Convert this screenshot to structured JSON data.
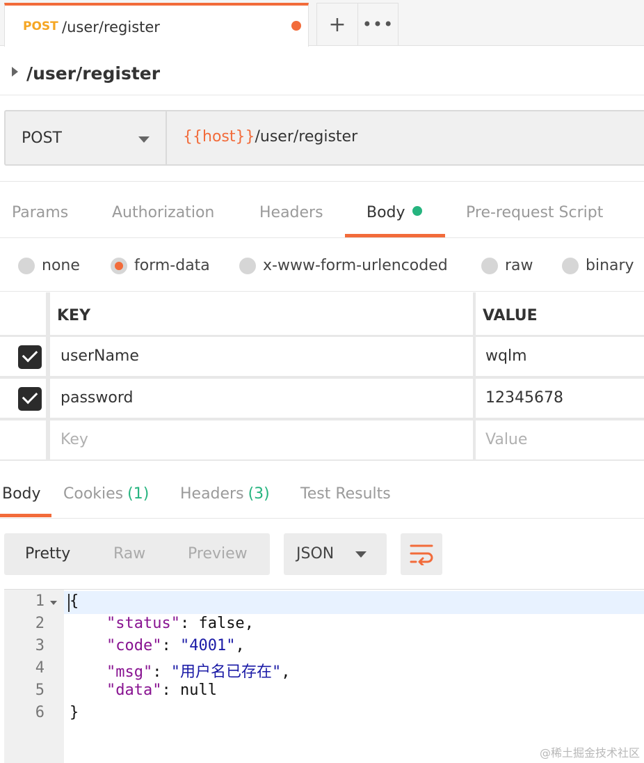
{
  "tab": {
    "method": "POST",
    "name": "/user/register"
  },
  "tab_buttons": {
    "add": "+",
    "more": "•••"
  },
  "request": {
    "title": "/user/register",
    "method": "POST",
    "url_var": "{{host}}",
    "url_path": "/user/register"
  },
  "request_tabs": [
    "Params",
    "Authorization",
    "Headers",
    "Body",
    "Pre-request Script"
  ],
  "body_types": [
    "none",
    "form-data",
    "x-www-form-urlencoded",
    "raw",
    "binary"
  ],
  "table": {
    "key_header": "KEY",
    "value_header": "VALUE",
    "rows": [
      {
        "key": "userName",
        "value": "wqlm"
      },
      {
        "key": "password",
        "value": "12345678"
      }
    ],
    "key_placeholder": "Key",
    "value_placeholder": "Value"
  },
  "response_tabs": {
    "body": "Body",
    "cookies": "Cookies",
    "cookies_count": "(1)",
    "headers": "Headers",
    "headers_count": "(3)",
    "tests": "Test Results"
  },
  "view_modes": [
    "Pretty",
    "Raw",
    "Preview"
  ],
  "format": "JSON",
  "code": {
    "line_numbers": [
      "1",
      "2",
      "3",
      "4",
      "5",
      "6"
    ],
    "open": "{",
    "close": "}",
    "status_key": "\"status\"",
    "status_val": "false",
    "code_key": "\"code\"",
    "code_val": "\"4001\"",
    "msg_key": "\"msg\"",
    "msg_val": "\"用户名已存在\"",
    "data_key": "\"data\"",
    "data_val": "null"
  },
  "watermark": "@稀土掘金技术社区",
  "colors": {
    "accent": "#f26b3a",
    "method": "#f5a623",
    "success": "#26b47f"
  }
}
